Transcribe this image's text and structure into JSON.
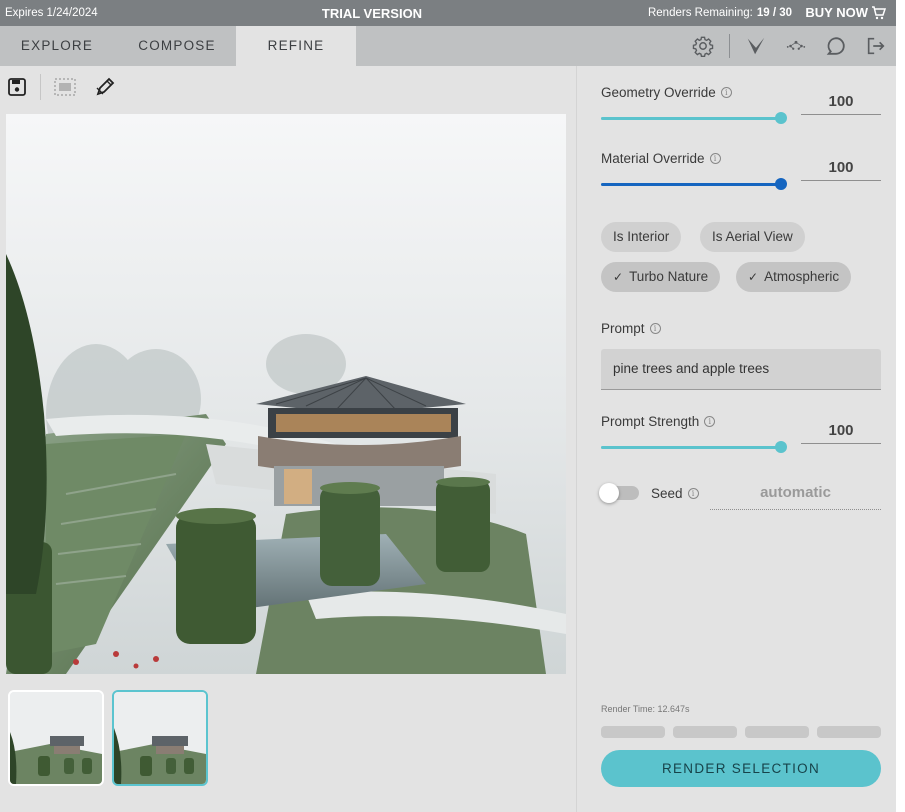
{
  "topbar": {
    "expires": "Expires 1/24/2024",
    "trial": "TRIAL VERSION",
    "renders_label": "Renders Remaining:",
    "renders_value": "19 / 30",
    "buy_now": "BUY NOW"
  },
  "tabs": [
    {
      "label": "EXPLORE",
      "active": false
    },
    {
      "label": "COMPOSE",
      "active": false
    },
    {
      "label": "REFINE",
      "active": true
    }
  ],
  "nav_icons": [
    "gear-icon",
    "check-logo-icon",
    "network-icon",
    "chat-icon",
    "logout-icon"
  ],
  "toolbar_icons": [
    "save-icon",
    "crop-image-icon",
    "edit-pen-icon"
  ],
  "params": {
    "geometry": {
      "label": "Geometry Override",
      "value": "100",
      "level": 1.0,
      "color": "#5bc3cd"
    },
    "material": {
      "label": "Material Override",
      "value": "100",
      "level": 1.0,
      "color": "#1565c0"
    },
    "prompt_strength": {
      "label": "Prompt Strength",
      "value": "100",
      "level": 1.0,
      "color": "#5bc3cd"
    }
  },
  "chips": [
    {
      "label": "Is Interior",
      "selected": false
    },
    {
      "label": "Is Aerial View",
      "selected": false
    },
    {
      "label": "Turbo Nature",
      "selected": true
    },
    {
      "label": "Atmospheric",
      "selected": true
    }
  ],
  "prompt": {
    "label": "Prompt",
    "value": "pine trees and apple trees"
  },
  "seed": {
    "label": "Seed",
    "value": "automatic",
    "enabled": false
  },
  "render_time": "Render Time: 12.647s",
  "render_button": "RENDER SELECTION",
  "colors": {
    "accent": "#5bc3cd",
    "topbar": "#7b7f82",
    "navbar": "#bfc1c2",
    "panel": "#e3e3e3"
  }
}
